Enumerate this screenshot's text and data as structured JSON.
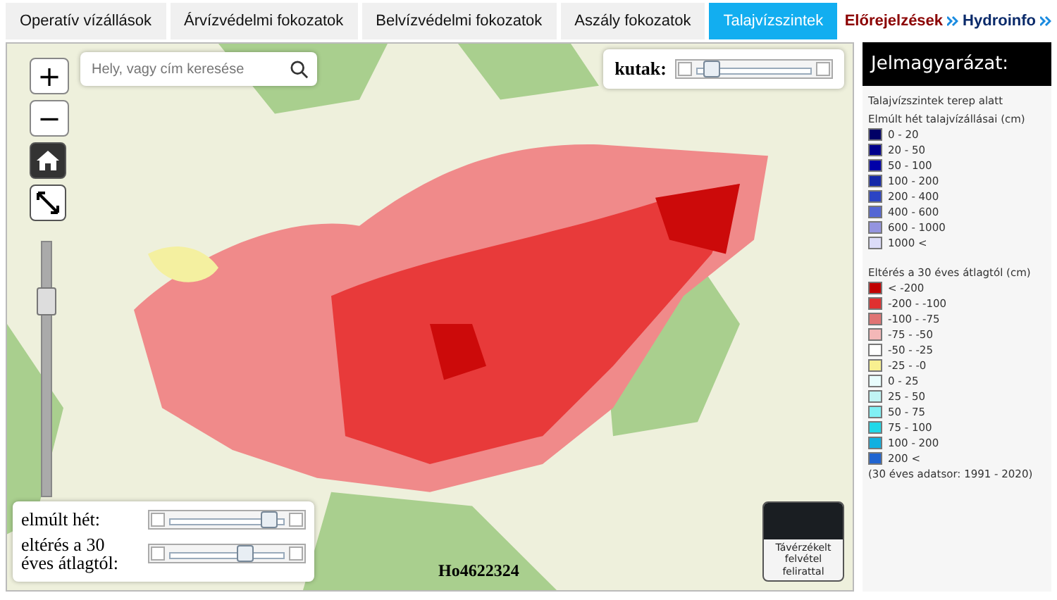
{
  "tabs": [
    {
      "label": "Operatív vízállások",
      "selected": false
    },
    {
      "label": "Árvízvédelmi fokozatok",
      "selected": false
    },
    {
      "label": "Belvízvédelmi fokozatok",
      "selected": false
    },
    {
      "label": "Aszály fokozatok",
      "selected": false
    },
    {
      "label": "Talajvízszintek",
      "selected": true
    }
  ],
  "header_links": [
    {
      "label": "Előrejelzések",
      "kind": "primary"
    },
    {
      "label": "Hydroinfo",
      "kind": "secondary"
    }
  ],
  "map": {
    "search": {
      "placeholder": "Hely, vagy cím keresése"
    },
    "zoom_in": "+",
    "zoom_out": "−",
    "zoom_slider": {
      "level": 0.8
    },
    "wells_slider": {
      "label": "kutak:",
      "level": 0.1
    },
    "time_sliders": [
      {
        "label": "elmúlt hét:",
        "level": 0.9
      },
      {
        "label": "eltérés a 30 éves átlagtól:",
        "level": 0.68
      }
    ],
    "well_id": "Ho4622324",
    "imagery_toggle": {
      "label": "Távérzékelt felvétel felirattal"
    }
  },
  "legend": {
    "title": "Jelmagyarázat:",
    "subtitle": "Talajvízszintek terep alatt",
    "sections": [
      {
        "heading": "Elmúlt hét talajvízállásai (cm)",
        "items": [
          {
            "label": "0 - 20",
            "color": "#000066"
          },
          {
            "label": "20 - 50",
            "color": "#00008b"
          },
          {
            "label": "50 - 100",
            "color": "#0000a8"
          },
          {
            "label": "100 - 200",
            "color": "#1428a8"
          },
          {
            "label": "200 - 400",
            "color": "#2c44c4"
          },
          {
            "label": "400 - 600",
            "color": "#5466d4"
          },
          {
            "label": "600 - 1000",
            "color": "#9494e0"
          },
          {
            "label": "1000 <",
            "color": "#dcdcf8"
          }
        ]
      },
      {
        "heading": "Eltérés a 30 éves átlagtól (cm)",
        "items": [
          {
            "label": "< -200",
            "color": "#c00000"
          },
          {
            "label": "-200 - -100",
            "color": "#e03030"
          },
          {
            "label": "-100 - -75",
            "color": "#e07474"
          },
          {
            "label": "-75 - -50",
            "color": "#f4b8b8"
          },
          {
            "label": "-50 - -25",
            "color": "#ffffff"
          },
          {
            "label": "-25 - -0",
            "color": "#f8f090"
          },
          {
            "label": "0 - 25",
            "color": "#e8fcfc"
          },
          {
            "label": "25 - 50",
            "color": "#c0f4f4"
          },
          {
            "label": "50 - 75",
            "color": "#80f0f4"
          },
          {
            "label": "75 - 100",
            "color": "#20d8e8"
          },
          {
            "label": "100 - 200",
            "color": "#10b0e0"
          },
          {
            "label": "200 <",
            "color": "#2064d0"
          }
        ]
      }
    ],
    "note": "(30 éves adatsor: 1991 - 2020)"
  }
}
